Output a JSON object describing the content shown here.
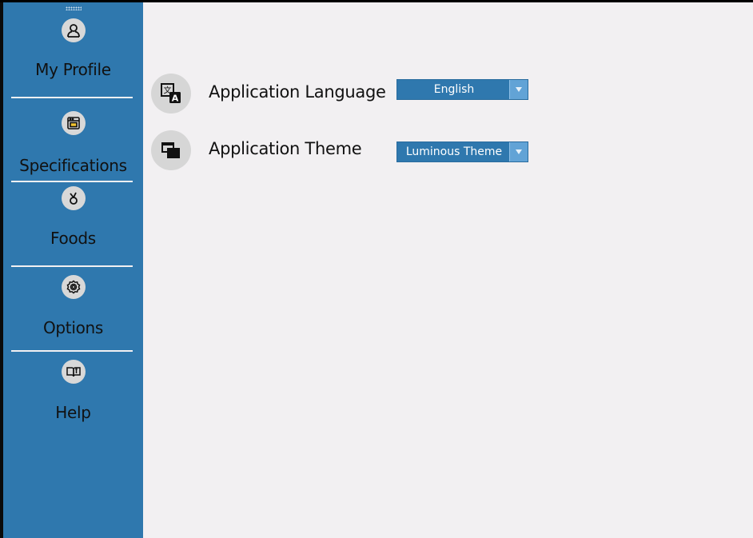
{
  "sidebar": {
    "items": [
      {
        "label": "My Profile",
        "icon": "person-icon"
      },
      {
        "label": "Specifications",
        "icon": "oven-icon"
      },
      {
        "label": "Foods",
        "icon": "food-icon"
      },
      {
        "label": "Options",
        "icon": "gear-icon"
      },
      {
        "label": "Help",
        "icon": "book-icon"
      }
    ]
  },
  "settings": {
    "language": {
      "label": "Application Language",
      "icon": "translate-icon",
      "value": "English"
    },
    "theme": {
      "label": "Application Theme",
      "icon": "windows-icon",
      "value": "Luminous Theme"
    }
  },
  "colors": {
    "sidebar": "#2f78ae",
    "content_background": "#f2f0f2",
    "combo_background": "#2f78ae",
    "combo_button": "#62a3d6"
  }
}
